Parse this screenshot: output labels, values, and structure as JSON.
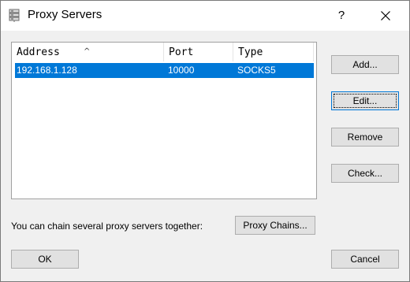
{
  "window": {
    "title": "Proxy Servers",
    "help_label": "?"
  },
  "table": {
    "columns": [
      "Address",
      "Port",
      "Type"
    ],
    "sort_indicator": "^",
    "rows": [
      {
        "address": "192.168.1.128",
        "port": "10000",
        "type": "SOCKS5",
        "selected": true
      }
    ]
  },
  "side_buttons": {
    "add": "Add...",
    "edit": "Edit...",
    "remove": "Remove",
    "check": "Check..."
  },
  "chain": {
    "label": "You can chain several proxy servers together:",
    "button": "Proxy Chains..."
  },
  "footer": {
    "ok": "OK",
    "cancel": "Cancel"
  },
  "colors": {
    "selection": "#0078d7",
    "button_face": "#e1e1e1",
    "dialog_bg": "#f0f0f0"
  }
}
